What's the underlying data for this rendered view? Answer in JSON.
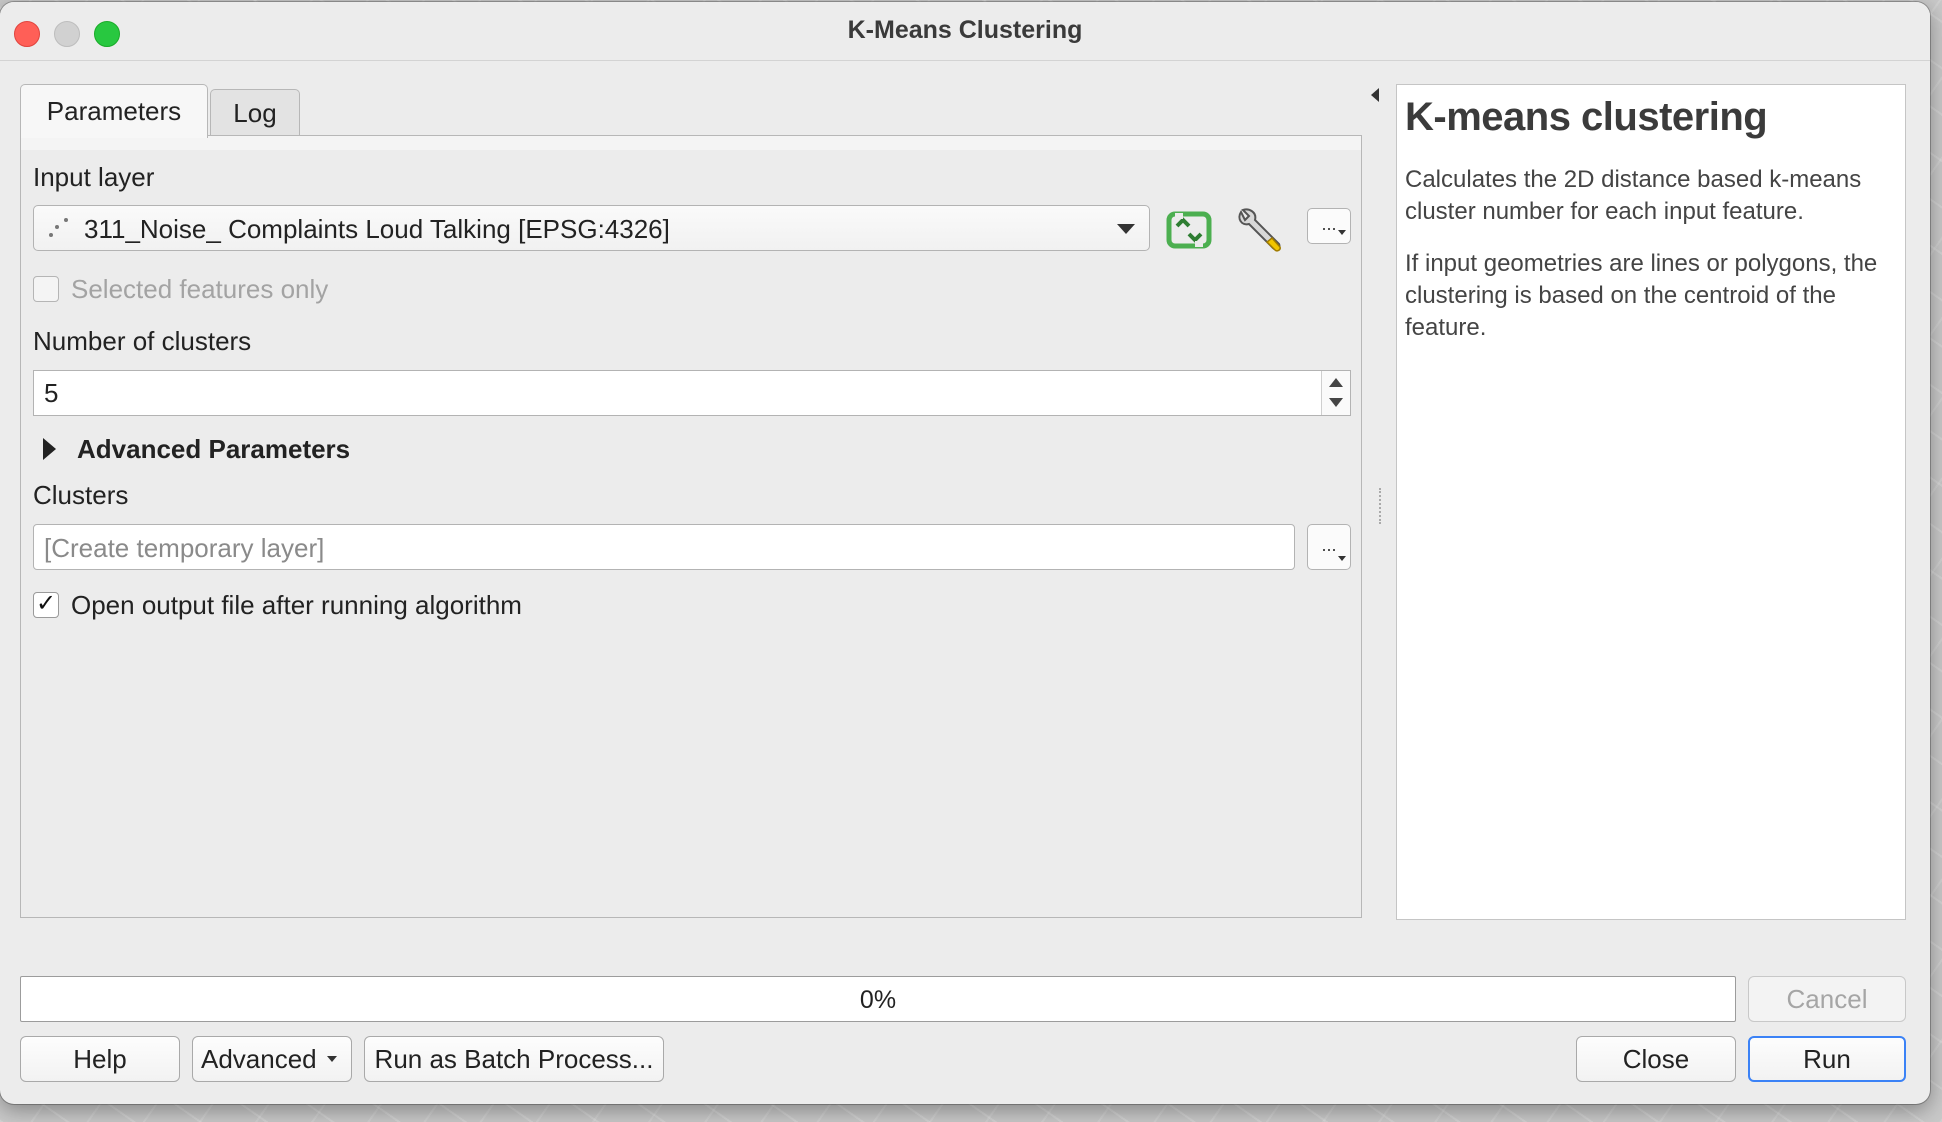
{
  "window": {
    "title": "K-Means Clustering"
  },
  "tabs": [
    {
      "label": "Parameters",
      "active": true
    },
    {
      "label": "Log",
      "active": false
    }
  ],
  "params": {
    "input_layer_label": "Input layer",
    "input_layer_value": "311_Noise_ Complaints Loud Talking [EPSG:4326]",
    "selected_only_label": "Selected features only",
    "selected_only_checked": false,
    "clusters_count_label": "Number of clusters",
    "clusters_count_value": "5",
    "advanced_label": "Advanced Parameters",
    "output_label": "Clusters",
    "output_placeholder": "[Create temporary layer]",
    "open_output_label": "Open output file after running algorithm",
    "open_output_checked": true,
    "dots": "..."
  },
  "help": {
    "title": "K-means clustering",
    "paragraphs": [
      "Calculates the 2D distance based k-means cluster number for each input feature.",
      "If input geometries are lines or polygons, the clustering is based on the centroid of the feature."
    ]
  },
  "progress": {
    "value": 0,
    "label": "0%"
  },
  "buttons": {
    "cancel": "Cancel",
    "help": "Help",
    "advanced": "Advanced",
    "batch": "Run as Batch Process...",
    "close": "Close",
    "run": "Run"
  },
  "icons": {
    "refresh": "iterate-refresh-icon",
    "settings": "wrench-icon",
    "layer_type": "point-layer-icon"
  },
  "colors": {
    "accent": "#3b82f6",
    "refresh_green": "#4caf50",
    "close_red": "#ff5f57",
    "max_green": "#28c840"
  }
}
